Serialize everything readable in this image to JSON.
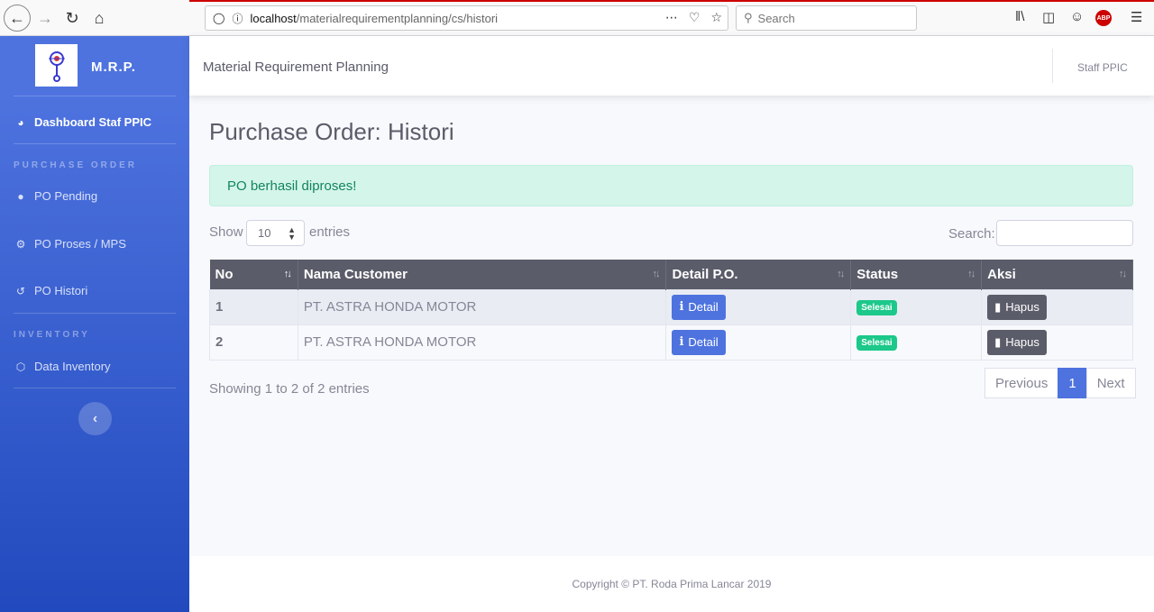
{
  "browser": {
    "url_host": "localhost",
    "url_path": "/materialrequirementplanning/cs/histori",
    "search_placeholder": "Search"
  },
  "sidebar": {
    "brand": "M.R.P.",
    "dashboard": "Dashboard Staf PPIC",
    "heading_po": "PURCHASE ORDER",
    "items_po": [
      {
        "label": "PO Pending",
        "icon": "info-circle-icon"
      },
      {
        "label": "PO Proses / MPS",
        "icon": "cogs-icon"
      },
      {
        "label": "PO Histori",
        "icon": "history-icon"
      }
    ],
    "heading_inventory": "INVENTORY",
    "items_inventory": [
      {
        "label": "Data Inventory",
        "icon": "cube-icon"
      }
    ]
  },
  "topbar": {
    "title": "Material Requirement Planning",
    "user": "Staff PPIC"
  },
  "main": {
    "page_title": "Purchase Order: Histori",
    "alert": "PO berhasil diproses!",
    "show_label": "Show",
    "entries_value": "10",
    "entries_label": "entries",
    "search_label": "Search:",
    "columns": [
      "No",
      "Nama Customer",
      "Detail P.O.",
      "Status",
      "Aksi"
    ],
    "rows": [
      {
        "no": "1",
        "customer": "PT. ASTRA HONDA MOTOR",
        "detail": "Detail",
        "status": "Selesai",
        "action": "Hapus"
      },
      {
        "no": "2",
        "customer": "PT. ASTRA HONDA MOTOR",
        "detail": "Detail",
        "status": "Selesai",
        "action": "Hapus"
      }
    ],
    "info": "Showing 1 to 2 of 2 entries",
    "pagination": {
      "previous": "Previous",
      "current": "1",
      "next": "Next"
    }
  },
  "footer": "Copyright © PT. Roda Prima Lancar 2019",
  "colors": {
    "primary": "#4e73df",
    "success": "#1cc88a",
    "dark": "#5a5c69"
  }
}
